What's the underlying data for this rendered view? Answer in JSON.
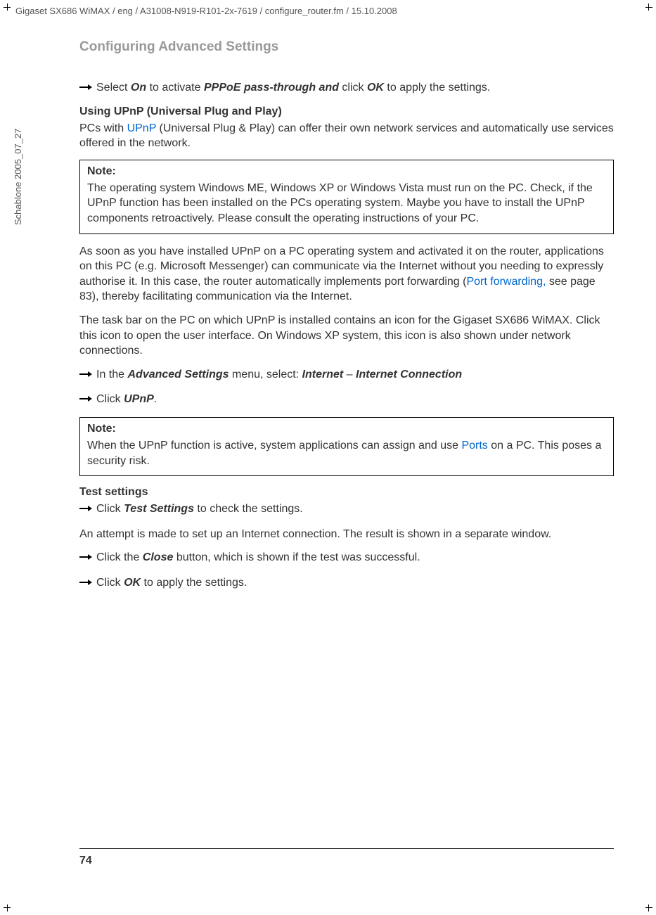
{
  "header": {
    "path": "Gigaset SX686 WiMAX / eng / A31008-N919-R101-2x-7619 / configure_router.fm / 15.10.2008"
  },
  "sidebar": {
    "vertical": "Schablone 2005_07_27"
  },
  "title": "Configuring Advanced Settings",
  "item1": {
    "pre": "Select ",
    "on": "On",
    "mid": " to activate ",
    "pppoe": "PPPoE pass-through and",
    "click": " click ",
    "ok": "OK",
    "end": " to apply the settings."
  },
  "upnp_heading": "Using UPnP (Universal Plug and Play)",
  "upnp_para": {
    "pre": "PCs with ",
    "link": "UPnP",
    "rest": " (Universal Plug & Play) can offer their own network services and automatically use services offered in the network."
  },
  "note1": {
    "title": "Note:",
    "text": "The operating system Windows ME, Windows XP or Windows Vista must run on the PC. Check, if the UPnP function has been installed on the PCs operating system. Maybe you have to install the UPnP components retroactively. Please consult the operating instructions of your PC."
  },
  "para2": {
    "pre": "As soon as you have installed UPnP on a PC operating system and activated it on the router, applications on this PC (e.g. Microsoft Messenger) can communicate via the Internet without you needing to expressly authorise it. In this case, the router automatically implements port forwarding (",
    "link": "Port forwarding,",
    "rest": " see page 83), thereby facilitating communication via the Internet."
  },
  "para3": "The task bar on the PC on which UPnP is installed contains an icon for the Gigaset SX686 WiMAX. Click this icon to open the user interface. On Windows XP system, this icon is also shown under network connections.",
  "item2": {
    "pre": "In the ",
    "adv": "Advanced Settings",
    "mid": " menu, select: ",
    "internet1": "Internet",
    "dash": " – ",
    "internet2": "Internet Connection"
  },
  "item3": {
    "pre": "Click ",
    "upnp": "UPnP",
    "end": "."
  },
  "note2": {
    "title": "Note:",
    "pre": "When the UPnP function is active, system applications can assign and use ",
    "link": "Ports",
    "rest": " on a PC. This poses a security risk."
  },
  "test_heading": "Test settings",
  "item4": {
    "pre": "Click ",
    "test": "Test Settings",
    "end": " to check the settings."
  },
  "para4": "An attempt is made to set up an Internet connection. The result is shown in a separate window.",
  "item5": {
    "pre": "Click the ",
    "close": "Close",
    "end": " button, which is shown if the test was successful."
  },
  "item6": {
    "pre": "Click ",
    "ok": "OK",
    "end": " to apply the settings."
  },
  "page_number": "74"
}
